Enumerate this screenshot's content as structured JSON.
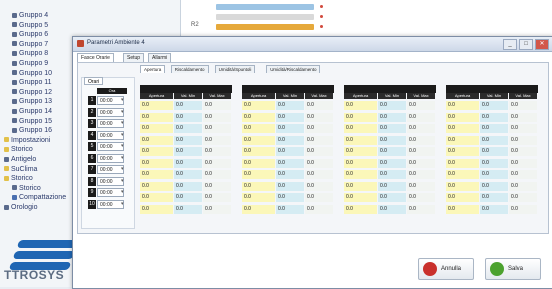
{
  "tree": {
    "items": [
      {
        "label": "Gruppo 4",
        "kind": "leaf",
        "indent": 1
      },
      {
        "label": "Gruppo 5",
        "kind": "leaf",
        "indent": 1
      },
      {
        "label": "Gruppo 6",
        "kind": "leaf",
        "indent": 1
      },
      {
        "label": "Gruppo 7",
        "kind": "leaf",
        "indent": 1
      },
      {
        "label": "Gruppo 8",
        "kind": "leaf",
        "indent": 1
      },
      {
        "label": "Gruppo 9",
        "kind": "leaf",
        "indent": 1
      },
      {
        "label": "Gruppo 10",
        "kind": "leaf",
        "indent": 1
      },
      {
        "label": "Gruppo 11",
        "kind": "leaf",
        "indent": 1
      },
      {
        "label": "Gruppo 12",
        "kind": "leaf",
        "indent": 1
      },
      {
        "label": "Gruppo 13",
        "kind": "leaf",
        "indent": 1
      },
      {
        "label": "Gruppo 14",
        "kind": "leaf",
        "indent": 1
      },
      {
        "label": "Gruppo 15",
        "kind": "leaf",
        "indent": 1
      },
      {
        "label": "Gruppo 16",
        "kind": "leaf",
        "indent": 1
      },
      {
        "label": "Impostazioni",
        "kind": "folder",
        "indent": 0
      },
      {
        "label": "Storico",
        "kind": "folder",
        "indent": 0
      },
      {
        "label": "Antigelo",
        "kind": "leaf",
        "indent": 0
      },
      {
        "label": "SuClima",
        "kind": "folder",
        "indent": 0
      },
      {
        "label": "Storico",
        "kind": "folder",
        "indent": 0
      },
      {
        "label": "Storico",
        "kind": "leaf",
        "indent": 1
      },
      {
        "label": "Compattazione",
        "kind": "pc",
        "indent": 1
      },
      {
        "label": "Orologio",
        "kind": "leaf",
        "indent": 0
      }
    ]
  },
  "logo": {
    "text": "TTROSYS"
  },
  "bg_list": {
    "rows": [
      {
        "label": "",
        "bar_color": "#9cc4e4",
        "bar_fraction": 0.35
      },
      {
        "label": "",
        "bar_color": "#d9d9d9",
        "bar_fraction": 0.35
      },
      {
        "label": "R2",
        "bar_color": "#e6a93b",
        "bar_fraction": 0.35
      }
    ],
    "marker_color": "#d24a3e"
  },
  "dialog": {
    "title": "Parametri Ambiente 4",
    "window_buttons": [
      "_",
      "□",
      "✕"
    ],
    "tabs": [
      {
        "label": "Fasce Orarie",
        "active": true
      },
      {
        "label": "Setup",
        "active": false
      },
      {
        "label": "Allarmi",
        "active": false
      }
    ],
    "inner_tabs": [
      {
        "label": "Apertura"
      },
      {
        "label": "Riscaldamento"
      },
      {
        "label": "Umidità/Spuntoli"
      },
      {
        "label": "Umidità/Riscaldamento"
      }
    ],
    "left_tab": "Orari",
    "left_header": "Ora",
    "schedule_rows": [
      {
        "n": "1",
        "time": "00:00"
      },
      {
        "n": "2",
        "time": "00:00"
      },
      {
        "n": "3",
        "time": "00:00"
      },
      {
        "n": "4",
        "time": "00:00"
      },
      {
        "n": "5",
        "time": "00:00"
      },
      {
        "n": "6",
        "time": "00:00"
      },
      {
        "n": "7",
        "time": "00:00"
      },
      {
        "n": "8",
        "time": "00:00"
      },
      {
        "n": "9",
        "time": "00:00"
      },
      {
        "n": "10",
        "time": "00:00"
      }
    ],
    "groups": [
      {
        "subcols": [
          "Apertura",
          "Val. Min",
          "Val. Max"
        ],
        "rows": [
          "0.0",
          "0.0",
          "0.0",
          "0.0",
          "0.0",
          "0.0",
          "0.0",
          "0.0",
          "0.0",
          "0.0"
        ]
      },
      {
        "subcols": [
          "Apertura",
          "Val. Min",
          "Val. Max"
        ],
        "rows": [
          "0.0",
          "0.0",
          "0.0",
          "0.0",
          "0.0",
          "0.0",
          "0.0",
          "0.0",
          "0.0",
          "0.0"
        ]
      },
      {
        "subcols": [
          "Apertura",
          "Val. Min",
          "Val. Max"
        ],
        "rows": [
          "0.0",
          "0.0",
          "0.0",
          "0.0",
          "0.0",
          "0.0",
          "0.0",
          "0.0",
          "0.0",
          "0.0"
        ]
      },
      {
        "subcols": [
          "Apertura",
          "Val. Min",
          "Val. Max"
        ],
        "rows": [
          "0.0",
          "0.0",
          "0.0",
          "0.0",
          "0.0",
          "0.0",
          "0.0",
          "0.0",
          "0.0",
          "0.0"
        ]
      }
    ],
    "buttons": {
      "cancel": "Annulla",
      "save": "Salva"
    },
    "button_colors": {
      "cancel": "#c9302c",
      "save": "#4ca22f"
    }
  }
}
